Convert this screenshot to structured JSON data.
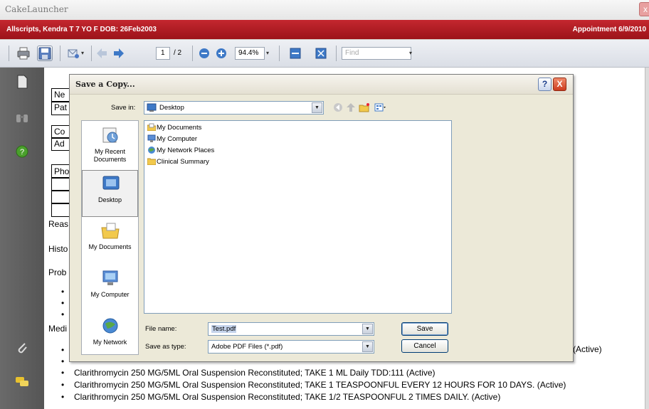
{
  "window": {
    "title": "CakeLauncher",
    "close_label": "x"
  },
  "patient_bar": {
    "patient": "Allscripts, Kendra T  7 YO  F DOB: 26Feb2003",
    "appointment": "Appointment  6/9/2010"
  },
  "toolbar": {
    "page_current": "1",
    "page_total": "/ 2",
    "zoom": "94.4%",
    "find_placeholder": "Find"
  },
  "document": {
    "box_labels": [
      "Ne",
      "Pat",
      "Co",
      "Ad",
      "Pho"
    ],
    "section_labels": [
      "Reas",
      "Histo",
      "Prob",
      "Medi"
    ],
    "partial_active": "(Active)",
    "medications": [
      "Clarithromycin 250 MG/5ML Oral Suspension Reconstituted; TAKE 1 ML Daily TDD:111 (Active)",
      "Clarithromycin 250 MG/5ML Oral Suspension Reconstituted; TAKE 1 TEASPOONFUL EVERY 12 HOURS FOR 10 DAYS. (Active)",
      "Clarithromycin 250 MG/5ML Oral Suspension Reconstituted; TAKE 1/2 TEASPOONFUL 2 TIMES DAILY. (Active)"
    ]
  },
  "dialog": {
    "title": "Save a Copy...",
    "help_label": "?",
    "close_label": "X",
    "save_in_label": "Save in:",
    "save_in_value": "Desktop",
    "places": [
      {
        "label": "My Recent Documents",
        "icon": "recent-documents-icon"
      },
      {
        "label": "Desktop",
        "icon": "desktop-icon"
      },
      {
        "label": "My Documents",
        "icon": "my-documents-icon"
      },
      {
        "label": "My Computer",
        "icon": "my-computer-icon"
      },
      {
        "label": "My Network",
        "icon": "my-network-icon"
      }
    ],
    "files": [
      {
        "name": "My Documents",
        "icon": "documents-folder-icon"
      },
      {
        "name": "My Computer",
        "icon": "computer-icon"
      },
      {
        "name": "My Network Places",
        "icon": "network-places-icon"
      },
      {
        "name": "Clinical Summary",
        "icon": "folder-icon"
      }
    ],
    "file_name_label": "File name:",
    "file_name_value": "Test.pdf",
    "save_as_type_label": "Save as type:",
    "save_as_type_value": "Adobe PDF Files (*.pdf)",
    "save_button": "Save",
    "cancel_button": "Cancel"
  },
  "colors": {
    "patient_bar": "#b01e25",
    "dialog_bg": "#ece9d8",
    "sidebar": "#5e5e5e"
  }
}
